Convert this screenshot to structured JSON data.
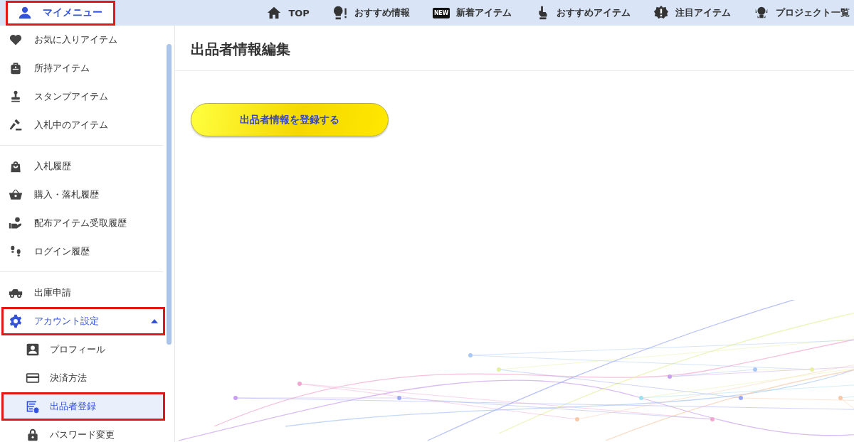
{
  "header": {
    "user_menu": {
      "label": "マイメニュー",
      "highlighted": true
    },
    "nav": [
      {
        "label": "TOP"
      },
      {
        "label": "おすすめ情報"
      },
      {
        "label": "新着アイテム",
        "badge": "NEW"
      },
      {
        "label": "おすすめアイテム"
      },
      {
        "label": "注目アイテム"
      },
      {
        "label": "プロジェクト一覧"
      }
    ]
  },
  "sidebar": {
    "groups": [
      {
        "items": [
          {
            "label": "お気に入りアイテム",
            "selected": false,
            "highlighted": false
          },
          {
            "label": "所持アイテム",
            "selected": false,
            "highlighted": false
          },
          {
            "label": "スタンプアイテム",
            "selected": false,
            "highlighted": false
          },
          {
            "label": "入札中のアイテム",
            "selected": false,
            "highlighted": false
          }
        ]
      },
      {
        "items": [
          {
            "label": "入札履歴",
            "selected": false,
            "highlighted": false
          },
          {
            "label": "購入・落札履歴",
            "selected": false,
            "highlighted": false
          },
          {
            "label": "配布アイテム受取履歴",
            "selected": false,
            "highlighted": false
          },
          {
            "label": "ログイン履歴",
            "selected": false,
            "highlighted": false
          }
        ]
      },
      {
        "items": [
          {
            "label": "出庫申請",
            "selected": false,
            "highlighted": false
          },
          {
            "label": "アカウント設定",
            "selected": false,
            "highlighted": true,
            "expanded": true,
            "children": [
              {
                "label": "プロフィール",
                "selected": false,
                "highlighted": false
              },
              {
                "label": "決済方法",
                "selected": false,
                "highlighted": false
              },
              {
                "label": "出品者登録",
                "selected": true,
                "highlighted": true
              },
              {
                "label": "パスワード変更",
                "selected": false,
                "highlighted": false
              }
            ]
          }
        ]
      }
    ]
  },
  "main": {
    "title": "出品者情報編集",
    "button": "出品者情報を登録する"
  }
}
